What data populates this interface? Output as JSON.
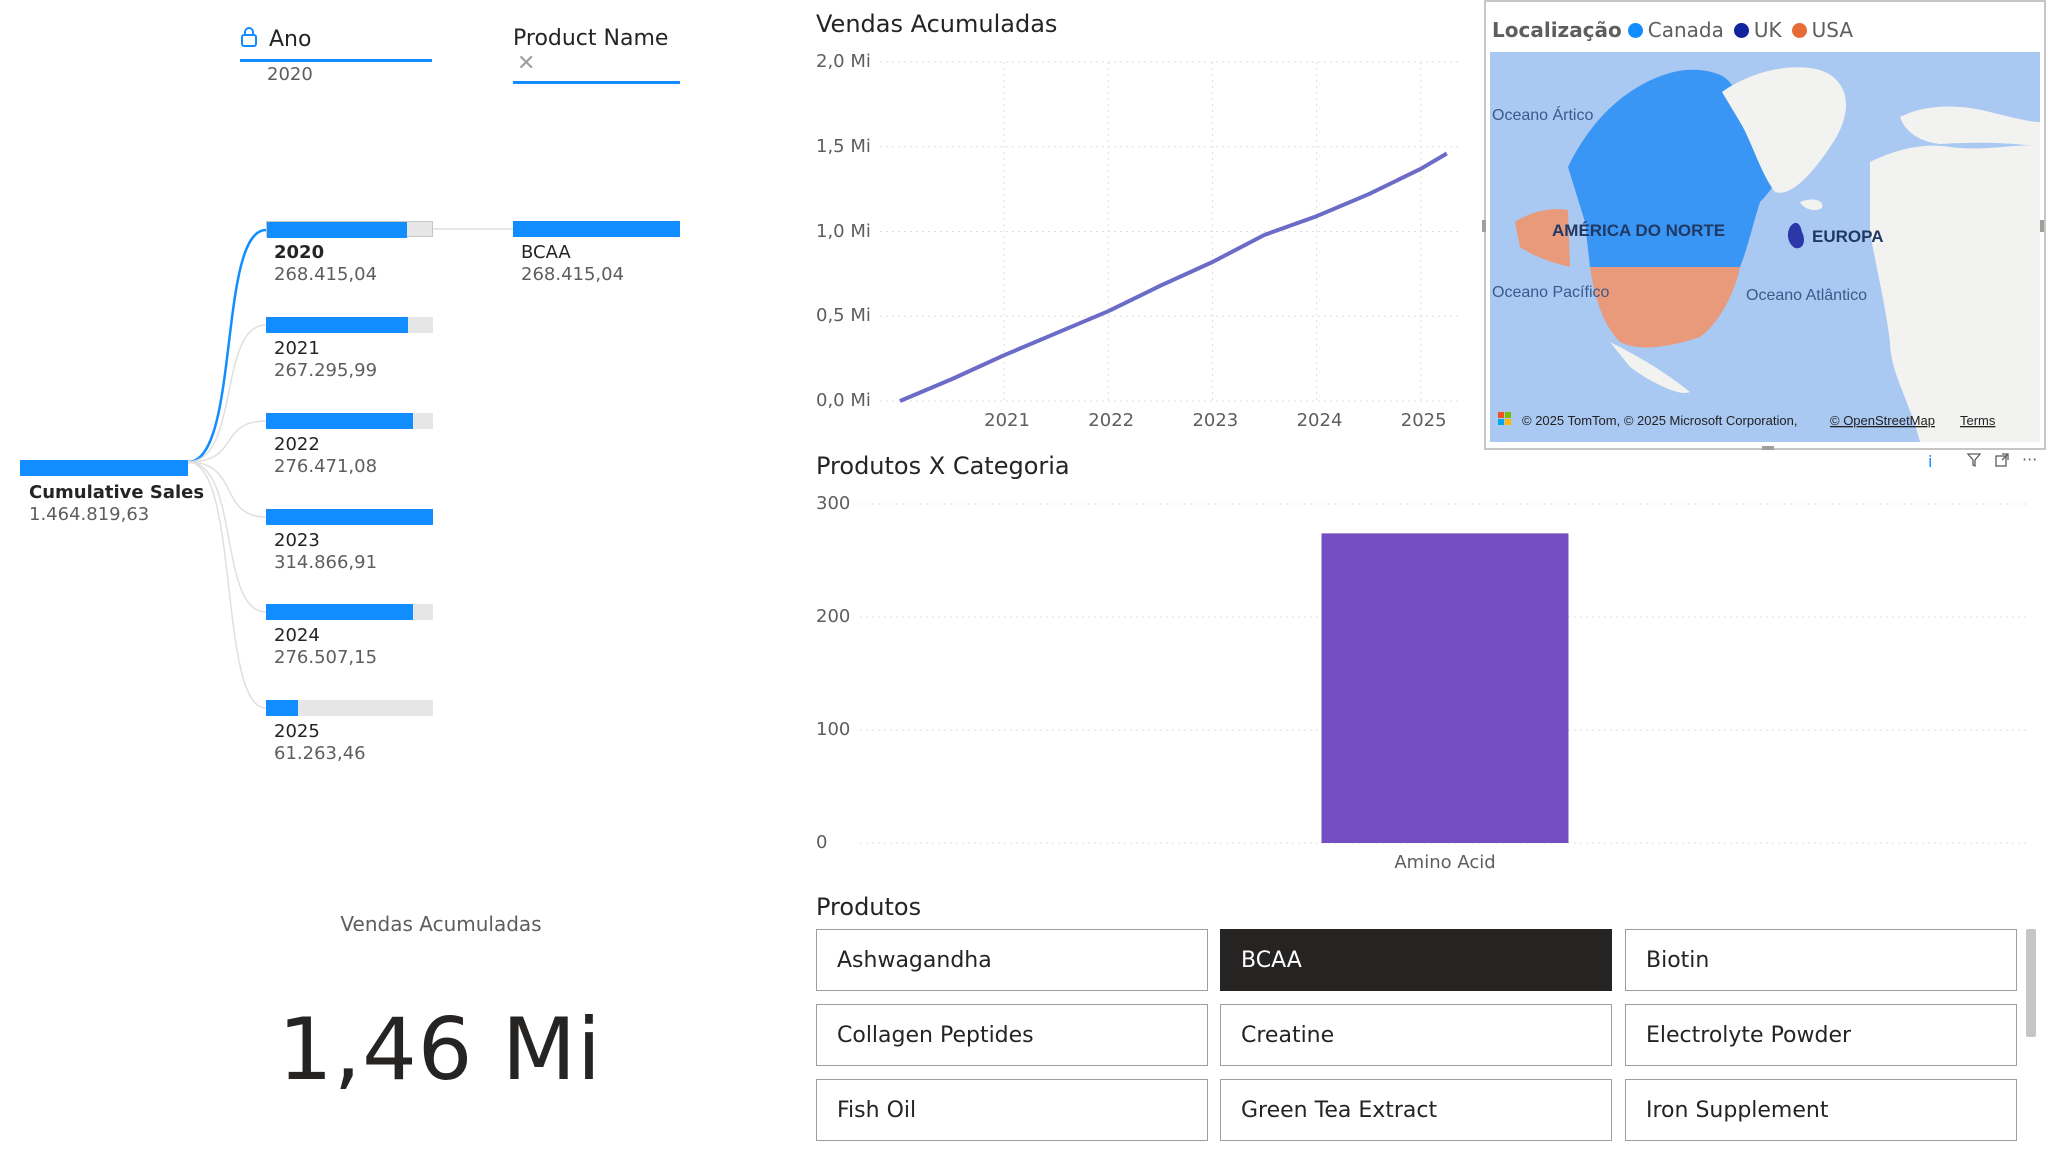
{
  "decomp_tree": {
    "headers": {
      "level1": {
        "title": "Ano",
        "subtitle": "2020"
      },
      "level2": {
        "title": "Product Name"
      }
    },
    "root": {
      "label": "Cumulative Sales",
      "value": "1.464.819,63"
    },
    "years": [
      {
        "label": "2020",
        "value": "268.415,04",
        "fill": 0.85,
        "selected": true
      },
      {
        "label": "2021",
        "value": "267.295,99",
        "fill": 0.85
      },
      {
        "label": "2022",
        "value": "276.471,08",
        "fill": 0.88
      },
      {
        "label": "2023",
        "value": "314.866,91",
        "fill": 1.0
      },
      {
        "label": "2024",
        "value": "276.507,15",
        "fill": 0.88
      },
      {
        "label": "2025",
        "value": "61.263,46",
        "fill": 0.19
      }
    ],
    "product": {
      "label": "BCAA",
      "value": "268.415,04",
      "fill": 1.0
    }
  },
  "kpi": {
    "label": "Vendas Acumuladas",
    "value": "1,46 Mi"
  },
  "line_chart": {
    "title": "Vendas Acumuladas",
    "y_ticks": [
      "2,0 Mi",
      "1,5 Mi",
      "1,0 Mi",
      "0,5 Mi",
      "0,0 Mi"
    ],
    "x_ticks": [
      "2021",
      "2022",
      "2023",
      "2024",
      "2025"
    ],
    "color": "#6B6BC8"
  },
  "map": {
    "legend_title": "Localização",
    "legend": [
      {
        "name": "Canada",
        "color": "#118DFF"
      },
      {
        "name": "UK",
        "color": "#12239E"
      },
      {
        "name": "USA",
        "color": "#E66C37"
      }
    ],
    "labels": {
      "north_america": "AMÉRICA DO NORTE",
      "europe": "EUROPA",
      "arctic": "Oceano Ártico",
      "pacific": "Oceano Pacífico",
      "atlantic": "Oceano Atlântico",
      "copyright": "© 2025 TomTom, © 2025 Microsoft Corporation,",
      "osm": "© OpenStreetMap",
      "terms": "Terms"
    }
  },
  "bar_chart": {
    "title": "Produtos X Categoria",
    "y_ticks": [
      "300",
      "200",
      "100",
      "0"
    ],
    "bar_color": "#744EC2"
  },
  "slicer": {
    "title": "Produtos",
    "items": [
      {
        "label": "Ashwagandha",
        "selected": false
      },
      {
        "label": "BCAA",
        "selected": true
      },
      {
        "label": "Biotin",
        "selected": false
      },
      {
        "label": "Collagen Peptides",
        "selected": false
      },
      {
        "label": "Creatine",
        "selected": false
      },
      {
        "label": "Electrolyte Powder",
        "selected": false
      },
      {
        "label": "Fish Oil",
        "selected": false
      },
      {
        "label": "Green Tea Extract",
        "selected": false
      },
      {
        "label": "Iron Supplement",
        "selected": false
      }
    ]
  },
  "visual_header_icons": [
    "info-icon",
    "filter-icon",
    "focus-mode-icon",
    "more-options-icon"
  ],
  "chart_data": {
    "type": "line",
    "title": "Vendas Acumuladas",
    "xlabel": "",
    "ylabel": "",
    "x": [
      2020.0,
      2020.5,
      2021.0,
      2021.5,
      2022.0,
      2022.5,
      2023.0,
      2023.5,
      2024.0,
      2024.5,
      2025.0,
      2025.25
    ],
    "values": [
      0.0,
      0.13,
      0.27,
      0.4,
      0.53,
      0.68,
      0.82,
      0.98,
      1.09,
      1.22,
      1.37,
      1.46
    ],
    "x_unit": "year",
    "y_unit": "Mi",
    "ylim": [
      0,
      2.0
    ],
    "grid": true,
    "bar": {
      "type": "bar",
      "title": "Produtos X Categoria",
      "categories": [
        "Amino Acid"
      ],
      "values": [
        274
      ],
      "ylim": [
        0,
        300
      ]
    }
  }
}
